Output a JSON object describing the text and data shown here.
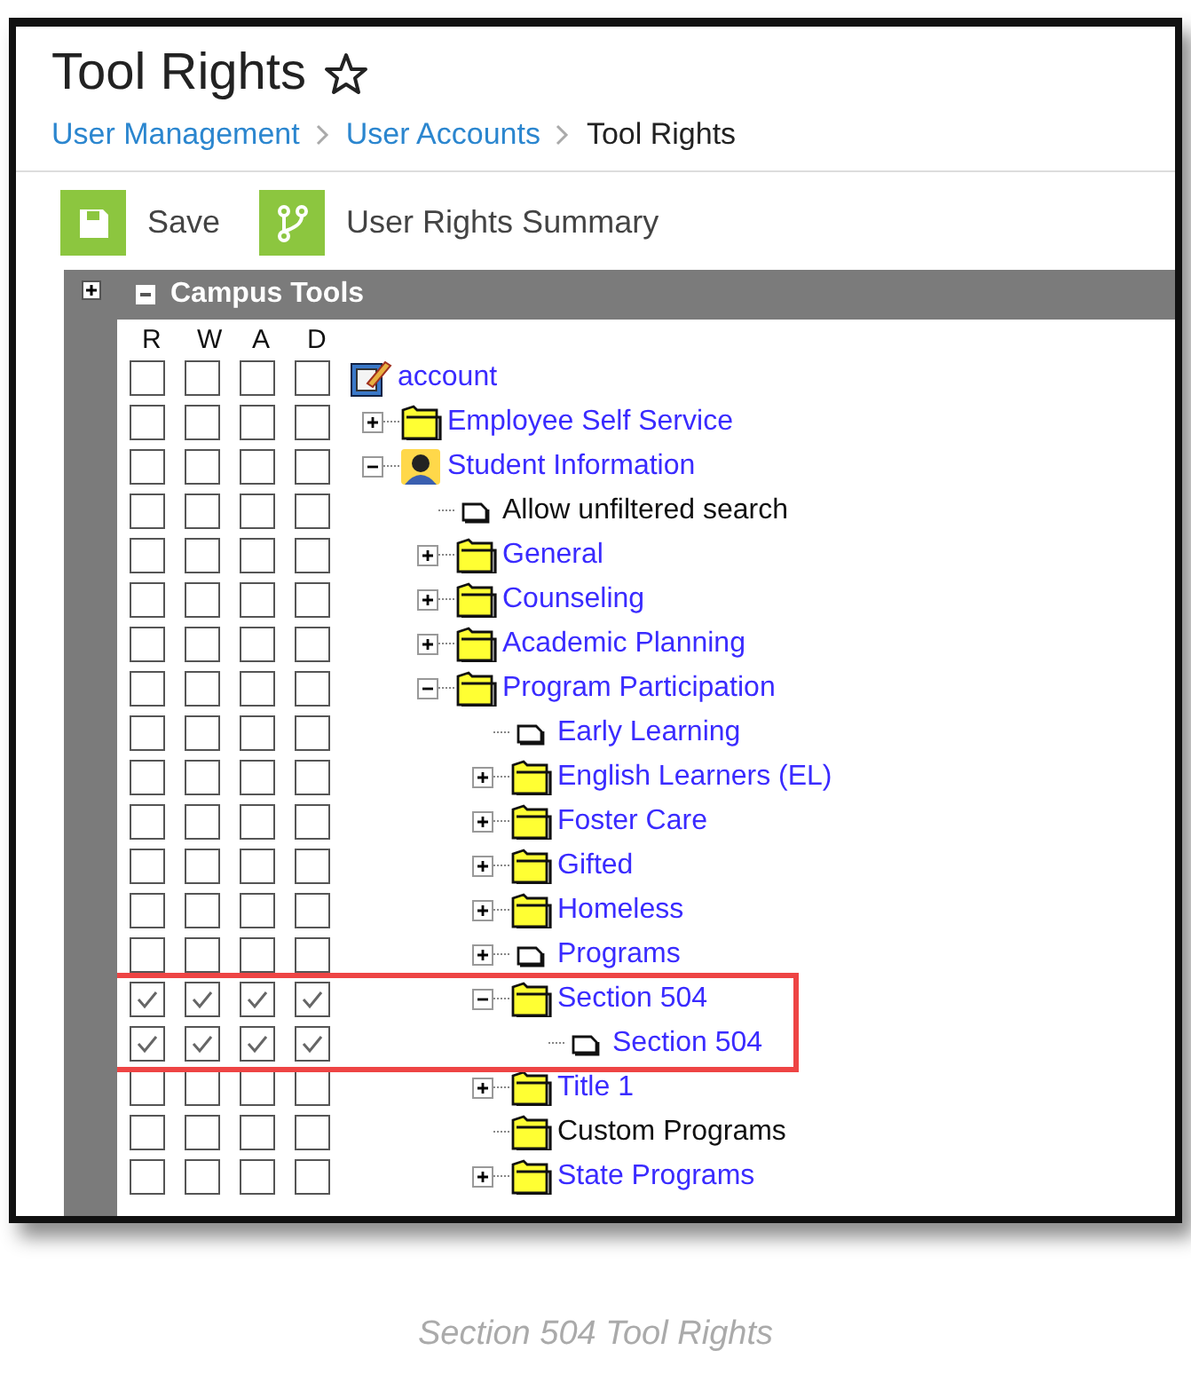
{
  "page": {
    "title": "Tool Rights",
    "breadcrumb": [
      {
        "label": "User Management",
        "current": false
      },
      {
        "label": "User Accounts",
        "current": false
      },
      {
        "label": "Tool Rights",
        "current": true
      }
    ]
  },
  "toolbar": [
    {
      "kind": "save",
      "label": "Save"
    },
    {
      "kind": "summary",
      "label": "User Rights Summary"
    }
  ],
  "panel": {
    "title": "Campus Tools",
    "expanded": true,
    "columns": [
      "R",
      "W",
      "A",
      "D"
    ],
    "tree": [
      {
        "label": "account",
        "kind": "account",
        "linked": true,
        "highlighted": false,
        "rights": [
          false,
          false,
          false,
          false
        ],
        "children": [
          {
            "label": "Employee Self Service",
            "kind": "folder",
            "linked": true,
            "expanded": false,
            "highlighted": false,
            "rights": [
              false,
              false,
              false,
              false
            ]
          },
          {
            "label": "Student Information",
            "kind": "student",
            "linked": true,
            "expanded": true,
            "highlighted": false,
            "rights": [
              false,
              false,
              false,
              false
            ],
            "children": [
              {
                "label": "Allow unfiltered search",
                "kind": "page",
                "linked": false,
                "highlighted": false,
                "rights": [
                  false,
                  false,
                  false,
                  false
                ]
              },
              {
                "label": "General",
                "kind": "folder",
                "linked": true,
                "expanded": false,
                "highlighted": false,
                "rights": [
                  false,
                  false,
                  false,
                  false
                ]
              },
              {
                "label": "Counseling",
                "kind": "folder",
                "linked": true,
                "expanded": false,
                "highlighted": false,
                "rights": [
                  false,
                  false,
                  false,
                  false
                ]
              },
              {
                "label": "Academic Planning",
                "kind": "folder",
                "linked": true,
                "expanded": false,
                "highlighted": false,
                "rights": [
                  false,
                  false,
                  false,
                  false
                ]
              },
              {
                "label": "Program Participation",
                "kind": "folder",
                "linked": true,
                "expanded": true,
                "highlighted": false,
                "rights": [
                  false,
                  false,
                  false,
                  false
                ],
                "children": [
                  {
                    "label": "Early Learning",
                    "kind": "page",
                    "linked": true,
                    "highlighted": false,
                    "rights": [
                      false,
                      false,
                      false,
                      false
                    ]
                  },
                  {
                    "label": "English Learners (EL)",
                    "kind": "folder",
                    "linked": true,
                    "expanded": false,
                    "highlighted": false,
                    "rights": [
                      false,
                      false,
                      false,
                      false
                    ]
                  },
                  {
                    "label": "Foster Care",
                    "kind": "folder",
                    "linked": true,
                    "expanded": false,
                    "highlighted": false,
                    "rights": [
                      false,
                      false,
                      false,
                      false
                    ]
                  },
                  {
                    "label": "Gifted",
                    "kind": "folder",
                    "linked": true,
                    "expanded": false,
                    "highlighted": false,
                    "rights": [
                      false,
                      false,
                      false,
                      false
                    ]
                  },
                  {
                    "label": "Homeless",
                    "kind": "folder",
                    "linked": true,
                    "expanded": false,
                    "highlighted": false,
                    "rights": [
                      false,
                      false,
                      false,
                      false
                    ]
                  },
                  {
                    "label": "Programs",
                    "kind": "page",
                    "linked": true,
                    "expanded": false,
                    "highlighted": false,
                    "rights": [
                      false,
                      false,
                      false,
                      false
                    ]
                  },
                  {
                    "label": "Section 504",
                    "kind": "folder",
                    "linked": true,
                    "expanded": true,
                    "highlighted": true,
                    "rights": [
                      true,
                      true,
                      true,
                      true
                    ],
                    "children": [
                      {
                        "label": "Section 504",
                        "kind": "page",
                        "linked": true,
                        "highlighted": true,
                        "rights": [
                          true,
                          true,
                          true,
                          true
                        ]
                      }
                    ]
                  },
                  {
                    "label": "Title 1",
                    "kind": "folder",
                    "linked": true,
                    "expanded": false,
                    "highlighted": false,
                    "rights": [
                      false,
                      false,
                      false,
                      false
                    ]
                  },
                  {
                    "label": "Custom Programs",
                    "kind": "folder",
                    "linked": false,
                    "highlighted": false,
                    "rights": [
                      false,
                      false,
                      false,
                      false
                    ]
                  },
                  {
                    "label": "State Programs",
                    "kind": "folder",
                    "linked": true,
                    "expanded": false,
                    "highlighted": false,
                    "rights": [
                      false,
                      false,
                      false,
                      false
                    ]
                  }
                ]
              }
            ]
          }
        ]
      }
    ]
  },
  "caption": "Section 504 Tool Rights"
}
